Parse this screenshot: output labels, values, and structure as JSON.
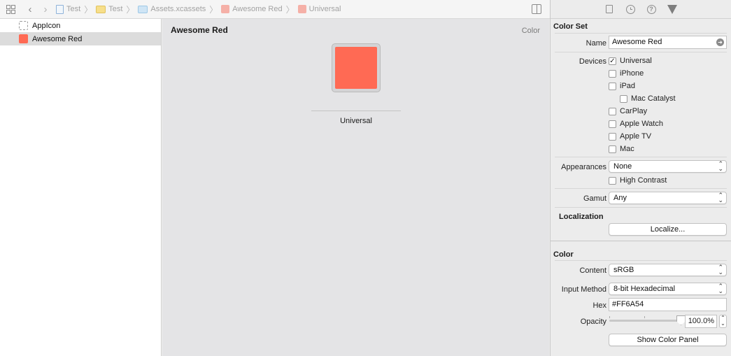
{
  "jumpbar": {
    "crumbs": [
      {
        "label": "Test",
        "icon": "project-file-icon"
      },
      {
        "label": "Test",
        "icon": "folder-icon"
      },
      {
        "label": "Assets.xcassets",
        "icon": "asset-catalog-icon"
      },
      {
        "label": "Awesome Red",
        "icon": "color-set-icon"
      },
      {
        "label": "Universal",
        "icon": "color-set-icon"
      }
    ]
  },
  "outline": {
    "items": [
      {
        "label": "AppIcon",
        "icon": "appicon-icon",
        "selected": false
      },
      {
        "label": "Awesome Red",
        "icon": "color-swatch-icon",
        "selected": true,
        "color": "#FF6A54"
      }
    ]
  },
  "editor": {
    "title": "Awesome Red",
    "kind": "Color",
    "swatch_color": "#FF6A54",
    "slot_label": "Universal"
  },
  "inspector": {
    "tabs": [
      "file-inspector-icon",
      "history-icon",
      "help-icon",
      "attributes-icon"
    ],
    "color_set_title": "Color Set",
    "name_label": "Name",
    "name_value": "Awesome Red",
    "devices_label": "Devices",
    "devices": [
      {
        "label": "Universal",
        "checked": true
      },
      {
        "label": "iPhone",
        "checked": false
      },
      {
        "label": "iPad",
        "checked": false
      },
      {
        "label": "Mac Catalyst",
        "checked": false
      },
      {
        "label": "CarPlay",
        "checked": false
      },
      {
        "label": "Apple Watch",
        "checked": false
      },
      {
        "label": "Apple TV",
        "checked": false
      },
      {
        "label": "Mac",
        "checked": false
      }
    ],
    "appearances_label": "Appearances",
    "appearances_value": "None",
    "high_contrast_label": "High Contrast",
    "high_contrast_checked": false,
    "gamut_label": "Gamut",
    "gamut_value": "Any",
    "localization_title": "Localization",
    "localize_button": "Localize...",
    "color_title": "Color",
    "content_label": "Content",
    "content_value": "sRGB",
    "input_method_label": "Input Method",
    "input_method_value": "8-bit Hexadecimal",
    "hex_label": "Hex",
    "hex_value": "#FF6A54",
    "opacity_label": "Opacity",
    "opacity_value": "100.0%",
    "opacity_level": 1.0,
    "show_color_panel_button": "Show Color Panel"
  }
}
